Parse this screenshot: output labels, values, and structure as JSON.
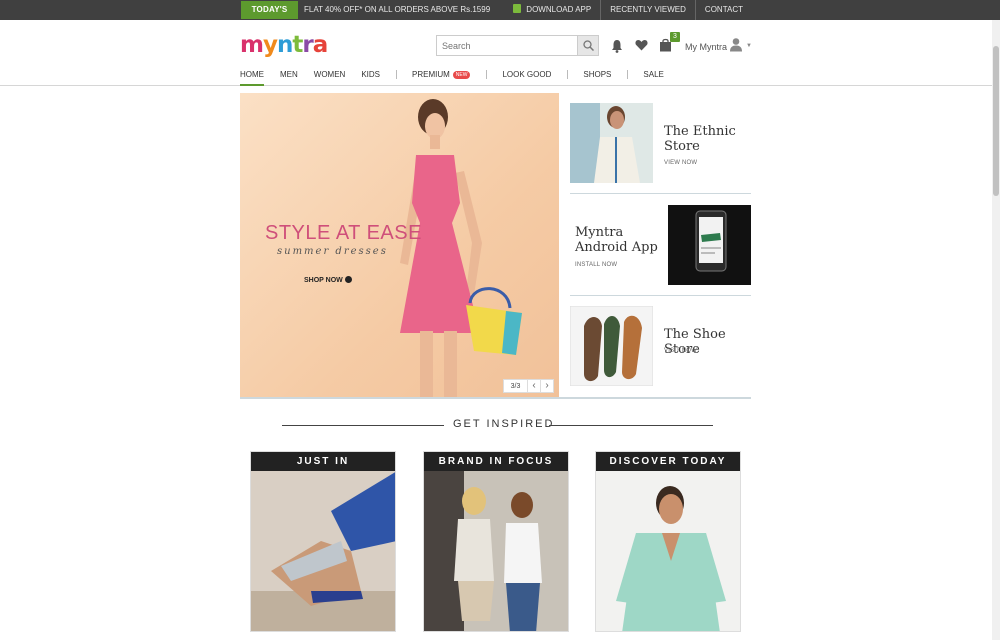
{
  "topbar": {
    "offer_tag": "TODAY'S OFFER",
    "offer_text": "FLAT 40% OFF* ON ALL ORDERS ABOVE Rs.1599",
    "links": [
      "DOWNLOAD APP",
      "RECENTLY VIEWED",
      "CONTACT"
    ]
  },
  "header": {
    "logo_text": "myntra",
    "search_placeholder": "Search",
    "bag_count": "3",
    "account_label": "My Myntra",
    "icons": [
      "bell-icon",
      "heart-icon",
      "bag-icon",
      "user-icon",
      "search-icon"
    ]
  },
  "nav": {
    "items": [
      "HOME",
      "MEN",
      "WOMEN",
      "KIDS",
      "PREMIUM",
      "LOOK GOOD",
      "SHOPS",
      "SALE"
    ],
    "premium_badge": "NEW",
    "active": "HOME"
  },
  "hero": {
    "title": "STYLE AT EASE",
    "subtitle": "summer dresses",
    "cta": "SHOP NOW",
    "pager": "3/3"
  },
  "promos": [
    {
      "title_line1": "The Ethnic",
      "title_line2": "Store",
      "link": "VIEW NOW"
    },
    {
      "title_line1": "Myntra",
      "title_line2": "Android App",
      "link": "INSTALL NOW"
    },
    {
      "title_line1": "The Shoe Store",
      "title_line2": "",
      "link": "VISIT NOW"
    }
  ],
  "inspired": {
    "title": "GET INSPIRED",
    "cards": [
      "JUST IN",
      "BRAND IN FOCUS",
      "DISCOVER TODAY"
    ]
  },
  "colors": {
    "topbar_bg": "#404040",
    "accent_green": "#5d9a2e",
    "hero_title": "#cf4f7a"
  }
}
